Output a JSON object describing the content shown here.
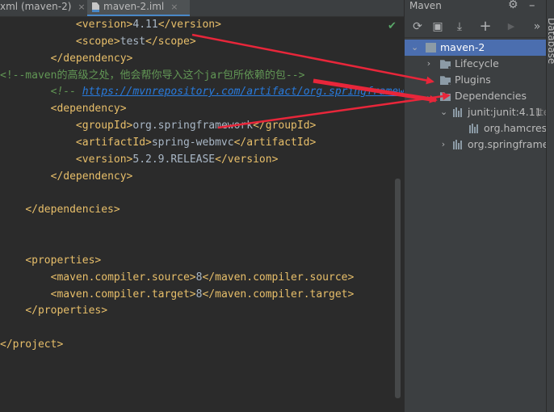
{
  "tabs": [
    {
      "label": "xml (maven-2)",
      "close": "×"
    },
    {
      "label": "maven-2.iml",
      "close": "×"
    }
  ],
  "editor": {
    "lines": [
      {
        "pre": "            ",
        "open": "<version>",
        "text": "4.11",
        "close": "</version>"
      },
      {
        "pre": "            ",
        "open": "<scope>",
        "text": "test",
        "close": "</scope>"
      },
      {
        "pre": "        ",
        "open": "</dependency>"
      },
      {
        "comment": "<!--maven的高级之处，他会帮你导入这个jar包所依赖的包-->"
      },
      {
        "pre": "        ",
        "cmstart": "<!-- ",
        "link": "https://mvnrepository.com/artifact/org.springframework"
      },
      {
        "pre": "        ",
        "open": "<dependency>"
      },
      {
        "pre": "            ",
        "open": "<groupId>",
        "text": "org.springframework",
        "close": "</groupId>"
      },
      {
        "pre": "            ",
        "open": "<artifactId>",
        "text": "spring-webmvc",
        "close": "</artifactId>"
      },
      {
        "pre": "            ",
        "open": "<version>",
        "text": "5.2.9.RELEASE",
        "close": "</version>"
      },
      {
        "pre": "        ",
        "open": "</dependency>"
      },
      {
        "blank": true
      },
      {
        "pre": "    ",
        "open": "</dependencies>"
      },
      {
        "blank": true
      },
      {
        "blank": true
      },
      {
        "pre": "    ",
        "open": "<properties>"
      },
      {
        "pre": "        ",
        "open": "<maven.compiler.source>",
        "text": "8",
        "close": "</maven.compiler.source>"
      },
      {
        "pre": "        ",
        "open": "<maven.compiler.target>",
        "text": "8",
        "close": "</maven.compiler.target>"
      },
      {
        "pre": "    ",
        "open": "</properties>"
      },
      {
        "blank": true
      },
      {
        "pre": "",
        "open": "</project>"
      }
    ]
  },
  "maven_panel": {
    "title": "Maven",
    "toolbar": [
      "refresh-icon",
      "add-folder-icon",
      "download-icon",
      "add-icon",
      "run-icon",
      "more-icon"
    ],
    "toolbar_glyphs": {
      "refresh": "⟳",
      "folder": "▣",
      "download": "⤓",
      "add": "+",
      "run": "▶",
      "more": "»"
    },
    "tree": {
      "project": "maven-2",
      "lifecycle": "Lifecycle",
      "plugins": "Plugins",
      "dependencies": "Dependencies",
      "junit": "junit:junit:4.11",
      "junit_scope": "(te",
      "hamcrest": "org.hamcrest",
      "spring": "org.springframew"
    }
  },
  "sidebar": {
    "label": "Database"
  },
  "colors": {
    "arrow": "#e8263a",
    "selection": "#4b6eaf",
    "tag": "#e8bf6a",
    "comment": "#629755",
    "link": "#287bde"
  }
}
